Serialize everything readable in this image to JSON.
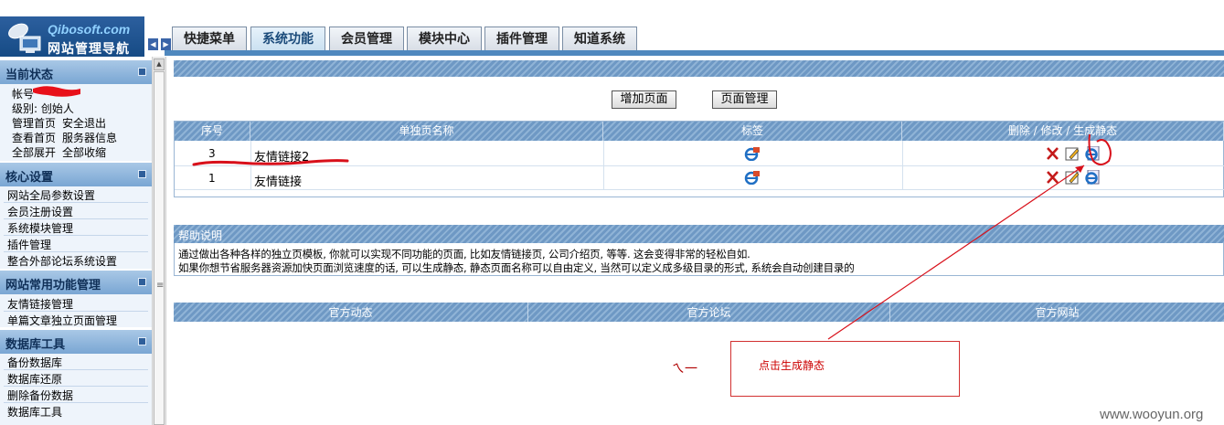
{
  "app": {
    "logo_domain": "Qibosoft.com",
    "logo_title": "网站管理导航"
  },
  "tabs": [
    {
      "label": "快捷菜单"
    },
    {
      "label": "系统功能"
    },
    {
      "label": "会员管理"
    },
    {
      "label": "模块中心"
    },
    {
      "label": "插件管理"
    },
    {
      "label": "知道系统"
    }
  ],
  "sidebar": {
    "status": {
      "title": "当前状态",
      "account_label": "帐号",
      "level_text": "级别:  创始人",
      "links_row1": [
        "管理首页",
        "安全退出"
      ],
      "links_row2": [
        "查看首页",
        "服务器信息"
      ],
      "links_row3": [
        "全部展开",
        "全部收缩"
      ]
    },
    "core": {
      "title": "核心设置",
      "items": [
        "网站全局参数设置",
        "会员注册设置",
        "系统模块管理",
        "插件管理",
        "整合外部论坛系统设置"
      ]
    },
    "common": {
      "title": "网站常用功能管理",
      "items": [
        "友情链接管理",
        "单篇文章独立页面管理"
      ]
    },
    "db": {
      "title": "数据库工具",
      "items": [
        "备份数据库",
        "数据库还原",
        "删除备份数据",
        "数据库工具"
      ]
    }
  },
  "main": {
    "add_page_button": "增加页面",
    "manage_page_button": "页面管理",
    "table": {
      "headers": [
        "序号",
        "单独页名称",
        "标签",
        "删除 / 修改 / 生成静态"
      ],
      "rows": [
        {
          "id": "3",
          "name": "友情链接2"
        },
        {
          "id": "1",
          "name": "友情链接"
        }
      ]
    },
    "help": {
      "title": "帮助说明",
      "line1": "通过做出各种各样的独立页模板, 你就可以实现不同功能的页面, 比如友情链接页, 公司介绍页, 等等. 这会变得非常的轻松自如.",
      "line2": "如果你想节省服务器资源加快页面浏览速度的话, 可以生成静态, 静态页面名称可以自由定义, 当然可以定义成多级目录的形式, 系统会自动创建目录的"
    },
    "footer": [
      "官方动态",
      "官方论坛",
      "官方网站"
    ]
  },
  "annotation": {
    "text": "点击生成静态",
    "scribble": "ㄟ一"
  },
  "watermark": "www.wooyun.org",
  "colors": {
    "header_blue": "#4f88be",
    "stripe_light": "#8fb3d6",
    "stripe_dark": "#6e98c4",
    "annotation_red": "#d23030",
    "sidebar_bg": "#eef4fb"
  },
  "icons": {
    "tag_icon": "ie-edit-icon",
    "delete": "red-x-delete-icon",
    "edit": "pencil-edit-icon",
    "static": "ie-generate-static-icon"
  }
}
